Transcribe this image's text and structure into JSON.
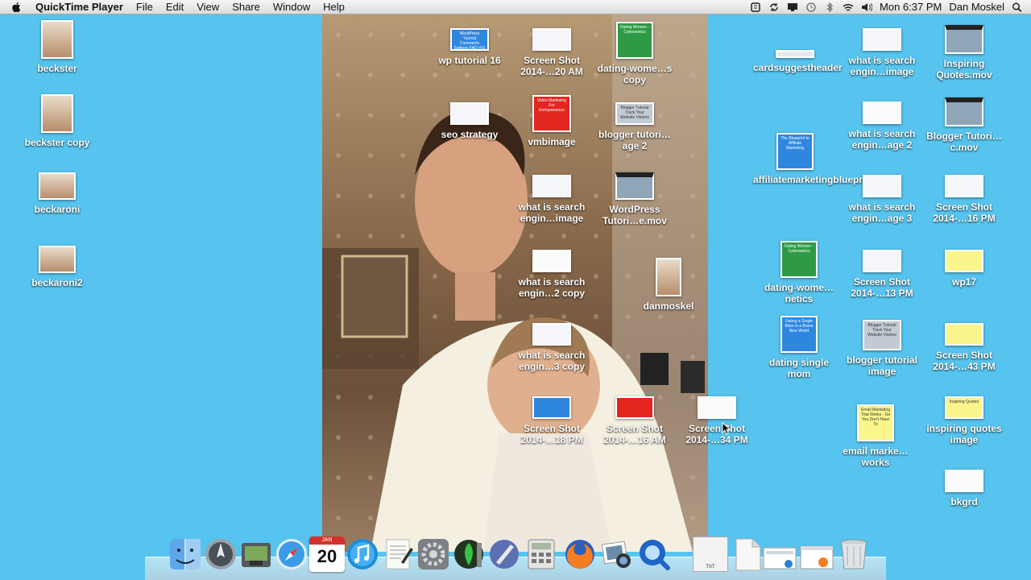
{
  "menubar": {
    "app_name": "QuickTime Player",
    "menus": [
      "File",
      "Edit",
      "View",
      "Share",
      "Window",
      "Help"
    ],
    "clock": "Mon 6:37 PM",
    "user": "Dan Moskel",
    "status_icons": [
      "notification-icon",
      "sync-icon",
      "display-icon",
      "time-machine-icon",
      "bluetooth-icon",
      "wifi-icon",
      "volume-icon",
      "spotlight-icon"
    ]
  },
  "desktop_icons": [
    {
      "label": "beckster",
      "kind": "photo"
    },
    {
      "label": "beckster copy",
      "kind": "photo"
    },
    {
      "label": "beckaroni",
      "kind": "photo"
    },
    {
      "label": "beckaroni2",
      "kind": "photo"
    },
    {
      "label": "wp tutorial 16",
      "kind": "screenshot-blue",
      "thumb_text": "WordPress Tutorial Comments Settings FAQ #16"
    },
    {
      "label": "Screen Shot 2014-…20 AM",
      "kind": "screenshot"
    },
    {
      "label": "dating-wome…s copy",
      "kind": "screenshot-green",
      "thumb_text": "Dating Women - Cyberwetics"
    },
    {
      "label": "seo strategy",
      "kind": "screenshot"
    },
    {
      "label": "vmbimage",
      "kind": "screenshot-red",
      "thumb_text": "Video Marketing For Entrepreneurs"
    },
    {
      "label": "blogger tutori…age 2",
      "kind": "screenshot-gray",
      "thumb_text": "Blogger Tutorial Track Your Website Visitors"
    },
    {
      "label": "what is search engin…image",
      "kind": "screenshot"
    },
    {
      "label": "WordPress Tutori…e.mov",
      "kind": "movie"
    },
    {
      "label": "what is search engin…2 copy",
      "kind": "screenshot-blank"
    },
    {
      "label": "danmoskel",
      "kind": "photo"
    },
    {
      "label": "what is search engin…3 copy",
      "kind": "screenshot"
    },
    {
      "label": "Screen Shot 2014-…18 PM",
      "kind": "screenshot-blue"
    },
    {
      "label": "Screen Shot 2014-…16 AM",
      "kind": "screenshot-red"
    },
    {
      "label": "Screen Shot 2014-…34 PM",
      "kind": "screenshot-blank"
    },
    {
      "label": "cardsuggestheader",
      "kind": "banner"
    },
    {
      "label": "what is search engin…image",
      "kind": "screenshot"
    },
    {
      "label": "Inspiring Quotes.mov",
      "kind": "movie"
    },
    {
      "label": "what is search engin…age 2",
      "kind": "screenshot-blank"
    },
    {
      "label": "Blogger Tutori…c.mov",
      "kind": "movie"
    },
    {
      "label": "affiliatemarketingblueprint",
      "kind": "screenshot-blue",
      "thumb_text": "The Blueprint to Affiliate Marketing"
    },
    {
      "label": "what is search engin…age 3",
      "kind": "screenshot"
    },
    {
      "label": "Screen Shot 2014-…16 PM",
      "kind": "screenshot"
    },
    {
      "label": "dating-wome…netics",
      "kind": "screenshot-green",
      "thumb_text": "Dating Women - Cyberwetics"
    },
    {
      "label": "Screen Shot 2014-…13 PM",
      "kind": "screenshot"
    },
    {
      "label": "wp17",
      "kind": "screenshot-yellow"
    },
    {
      "label": "dating single mom",
      "kind": "screenshot-blue",
      "thumb_text": "Dating a Single Mom in a Brave New World"
    },
    {
      "label": "blogger tutorial image",
      "kind": "screenshot-gray",
      "thumb_text": "Blogger Tutorial Track Your Website Visitors"
    },
    {
      "label": "Screen Shot 2014-…43 PM",
      "kind": "screenshot-yellow"
    },
    {
      "label": "email marke…works",
      "kind": "screenshot-yellow",
      "thumb_text": "Email Marketing That Works - Go You Don't Have To"
    },
    {
      "label": "inspiring quotes image",
      "kind": "screenshot-yellow",
      "thumb_text": "Inspiring Quotes"
    },
    {
      "label": "bkgrd",
      "kind": "screenshot-blank"
    }
  ],
  "dock": {
    "apps": [
      "finder-icon",
      "launchpad-icon",
      "image-capture-icon",
      "safari-icon",
      "calendar-icon",
      "itunes-icon",
      "textedit-icon",
      "system-preferences-icon",
      "screenflow-icon",
      "script-editor-icon",
      "calculator-icon",
      "firefox-icon",
      "iphoto-icon",
      "quicktime-icon"
    ],
    "calendar_day": "20",
    "calendar_month": "JAN",
    "stack_items": [
      "txt-document-icon",
      "blank-document-icon",
      "screenshot-stack-icon",
      "firefox-window-icon",
      "trash-icon"
    ],
    "txt_label": "TXT"
  }
}
